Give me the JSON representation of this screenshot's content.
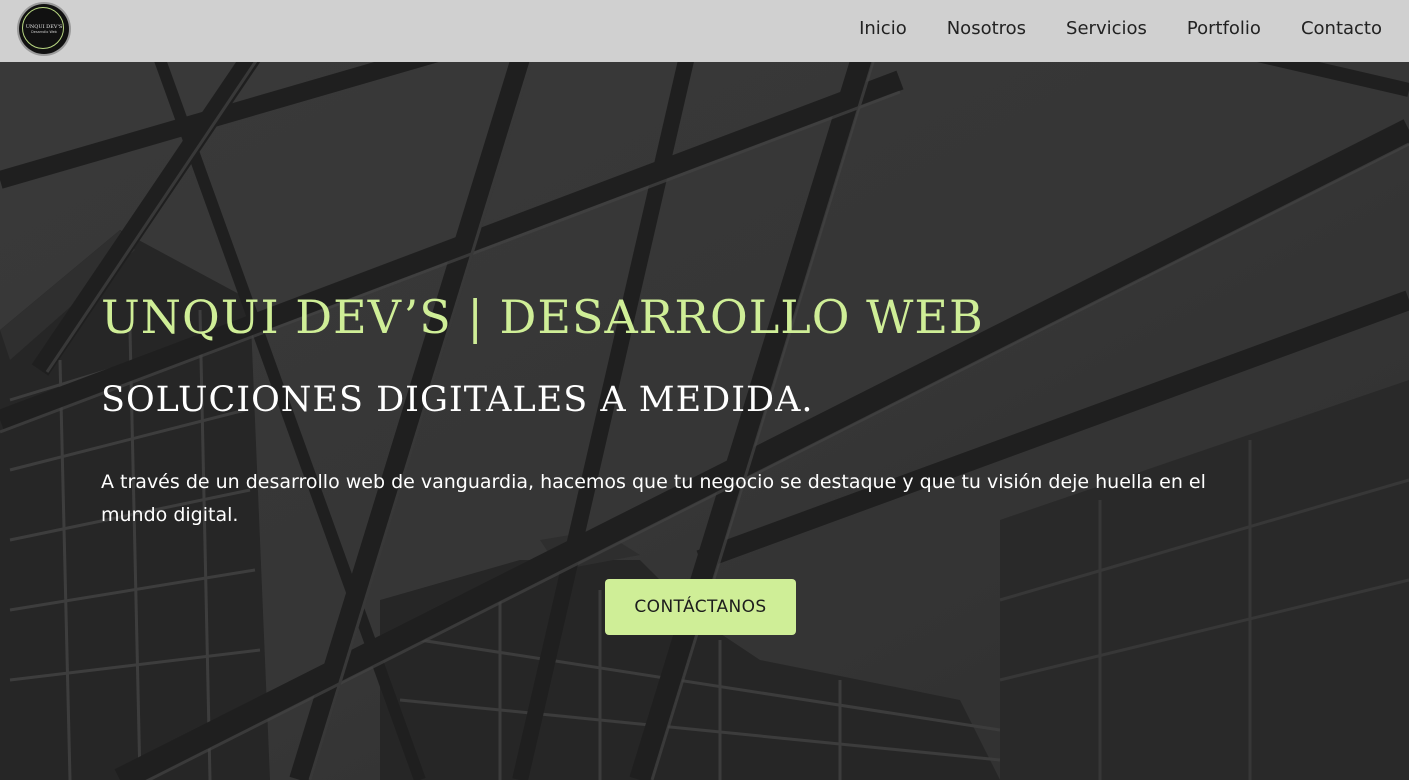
{
  "logo": {
    "line1": "UNQUI DEV'S",
    "line2": "Desarrollo Web"
  },
  "nav": {
    "items": [
      {
        "label": "Inicio"
      },
      {
        "label": "Nosotros"
      },
      {
        "label": "Servicios"
      },
      {
        "label": "Portfolio"
      },
      {
        "label": "Contacto"
      }
    ]
  },
  "hero": {
    "title": "UNQUI DEV’S | DESARROLLO WEB",
    "subtitle": "SOLUCIONES DIGITALES A MEDIDA.",
    "description": "A través de un desarrollo web de vanguardia, hacemos que tu negocio se destaque y que tu visión deje huella en el mundo digital.",
    "cta_label": "CONTÁCTANOS"
  },
  "colors": {
    "accent": "#cfee97",
    "nav_background": "#d0d0d0",
    "hero_text": "#ffffff"
  }
}
